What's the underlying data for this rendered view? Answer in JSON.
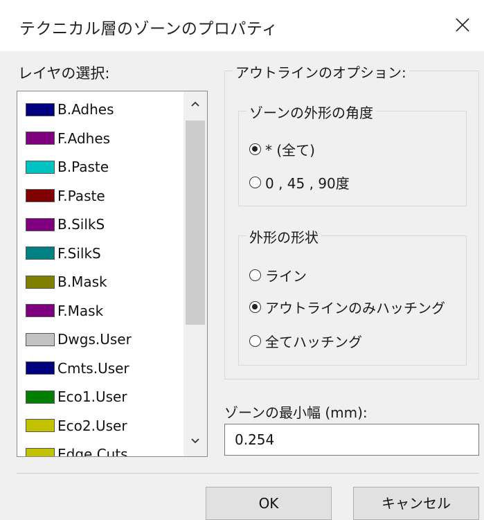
{
  "dialog": {
    "title": "テクニカル層のゾーンのプロパティ",
    "close_icon": "close-icon"
  },
  "layers": {
    "label": "レイヤの選択:",
    "items": [
      {
        "name": "B.Adhes",
        "color": "#00007f"
      },
      {
        "name": "F.Adhes",
        "color": "#7f007f"
      },
      {
        "name": "B.Paste",
        "color": "#00c2c2"
      },
      {
        "name": "F.Paste",
        "color": "#7f0000"
      },
      {
        "name": "B.SilkS",
        "color": "#7f007f"
      },
      {
        "name": "F.SilkS",
        "color": "#008080"
      },
      {
        "name": "B.Mask",
        "color": "#7f7f00"
      },
      {
        "name": "F.Mask",
        "color": "#7f007f"
      },
      {
        "name": "Dwgs.User",
        "color": "#c2c2c2"
      },
      {
        "name": "Cmts.User",
        "color": "#00007f"
      },
      {
        "name": "Eco1.User",
        "color": "#007f00"
      },
      {
        "name": "Eco2.User",
        "color": "#c2c200"
      },
      {
        "name": "Edge.Cuts",
        "color": "#c2c200"
      }
    ]
  },
  "outline_options": {
    "label": "アウトラインのオプション:",
    "angle_group": {
      "label": "ゾーンの外形の角度",
      "options": [
        "* (全て)",
        "0 , 45 , 90度"
      ],
      "selected_index": 0
    },
    "shape_group": {
      "label": "外形の形状",
      "options": [
        "ライン",
        "アウトラインのみハッチング",
        "全てハッチング"
      ],
      "selected_index": 1
    }
  },
  "min_width": {
    "label": "ゾーンの最小幅 (mm):",
    "value": "0.254"
  },
  "buttons": {
    "ok": "OK",
    "cancel": "キャンセル"
  }
}
